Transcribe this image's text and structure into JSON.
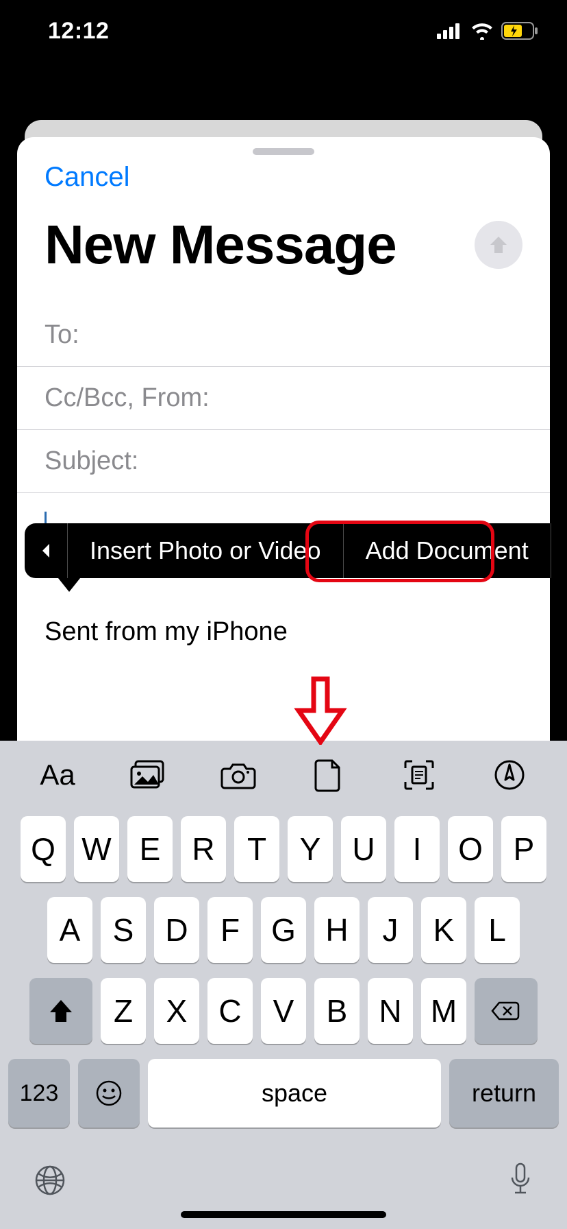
{
  "status": {
    "time": "12:12"
  },
  "compose": {
    "cancel": "Cancel",
    "title": "New Message",
    "to_label": "To:",
    "ccbcc_label": "Cc/Bcc, From:",
    "subject_label": "Subject:",
    "signature": "Sent from my iPhone"
  },
  "callout": {
    "insert_photo": "Insert Photo or Video",
    "add_document": "Add Document"
  },
  "toolbar": {
    "aa": "Aa"
  },
  "keyboard": {
    "row1": [
      "Q",
      "W",
      "E",
      "R",
      "T",
      "Y",
      "U",
      "I",
      "O",
      "P"
    ],
    "row2": [
      "A",
      "S",
      "D",
      "F",
      "G",
      "H",
      "J",
      "K",
      "L"
    ],
    "row3": [
      "Z",
      "X",
      "C",
      "V",
      "B",
      "N",
      "M"
    ],
    "numbers": "123",
    "space": "space",
    "return": "return"
  }
}
